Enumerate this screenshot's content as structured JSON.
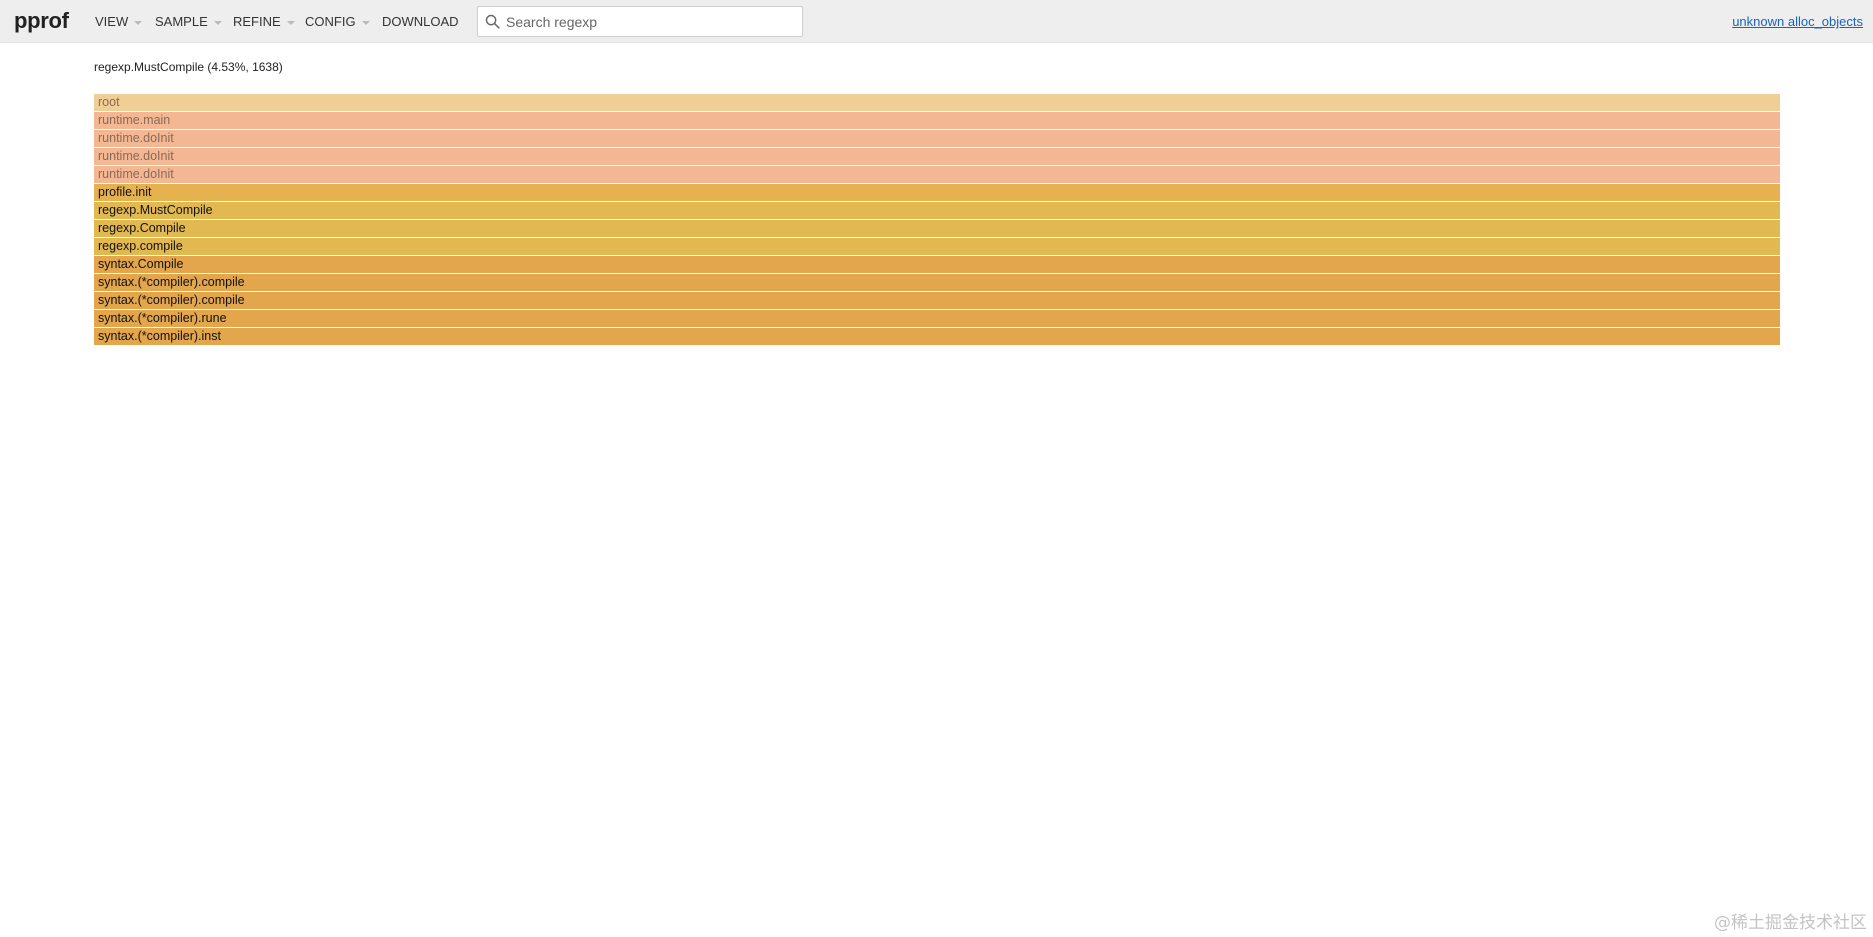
{
  "app": {
    "logo": "pprof"
  },
  "menu": {
    "view": "VIEW",
    "sample": "SAMPLE",
    "refine": "REFINE",
    "config": "CONFIG",
    "download": "DOWNLOAD"
  },
  "search": {
    "placeholder": "Search regexp",
    "value": ""
  },
  "sample_type_link": "unknown alloc_objects",
  "details": "regexp.MustCompile (4.53%, 1638)",
  "flamegraph": {
    "frames": [
      {
        "label": "root",
        "color": "#f0cf96",
        "dimmed": true
      },
      {
        "label": "runtime.main",
        "color": "#f3b893",
        "dimmed": true
      },
      {
        "label": "runtime.doInit",
        "color": "#f3b893",
        "dimmed": true
      },
      {
        "label": "runtime.doInit",
        "color": "#f3b893",
        "dimmed": true
      },
      {
        "label": "runtime.doInit",
        "color": "#f3b893",
        "dimmed": true
      },
      {
        "label": "profile.init",
        "color": "#e5b24f",
        "dimmed": false
      },
      {
        "label": "regexp.MustCompile",
        "color": "#e2b950",
        "dimmed": false
      },
      {
        "label": "regexp.Compile",
        "color": "#e2b950",
        "dimmed": false
      },
      {
        "label": "regexp.compile",
        "color": "#e2b950",
        "dimmed": false
      },
      {
        "label": "syntax.Compile",
        "color": "#e4a64c",
        "dimmed": false
      },
      {
        "label": "syntax.(*compiler).compile",
        "color": "#e4a64c",
        "dimmed": false
      },
      {
        "label": "syntax.(*compiler).compile",
        "color": "#e4a64c",
        "dimmed": false
      },
      {
        "label": "syntax.(*compiler).rune",
        "color": "#e4a64c",
        "dimmed": false
      },
      {
        "label": "syntax.(*compiler).inst",
        "color": "#e4a64c",
        "dimmed": false
      }
    ]
  },
  "watermark": "@稀土掘金技术社区"
}
